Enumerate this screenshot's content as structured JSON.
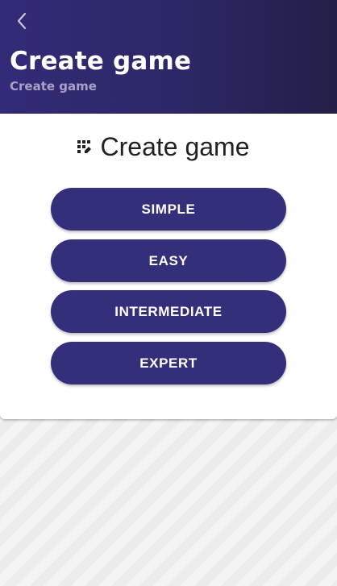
{
  "header": {
    "title": "Create game",
    "subtitle": "Create game",
    "back_icon": "chevron-left-icon"
  },
  "card": {
    "icon": "dice-grid-icon",
    "title": "Create game"
  },
  "levels": [
    {
      "label": "SIMPLE"
    },
    {
      "label": "EASY"
    },
    {
      "label": "INTERMEDIATE"
    },
    {
      "label": "EXPERT"
    }
  ],
  "colors": {
    "header_start": "#332b78",
    "header_end": "#231f46",
    "button": "#342f7a",
    "subtitle": "#a7a2c6"
  }
}
